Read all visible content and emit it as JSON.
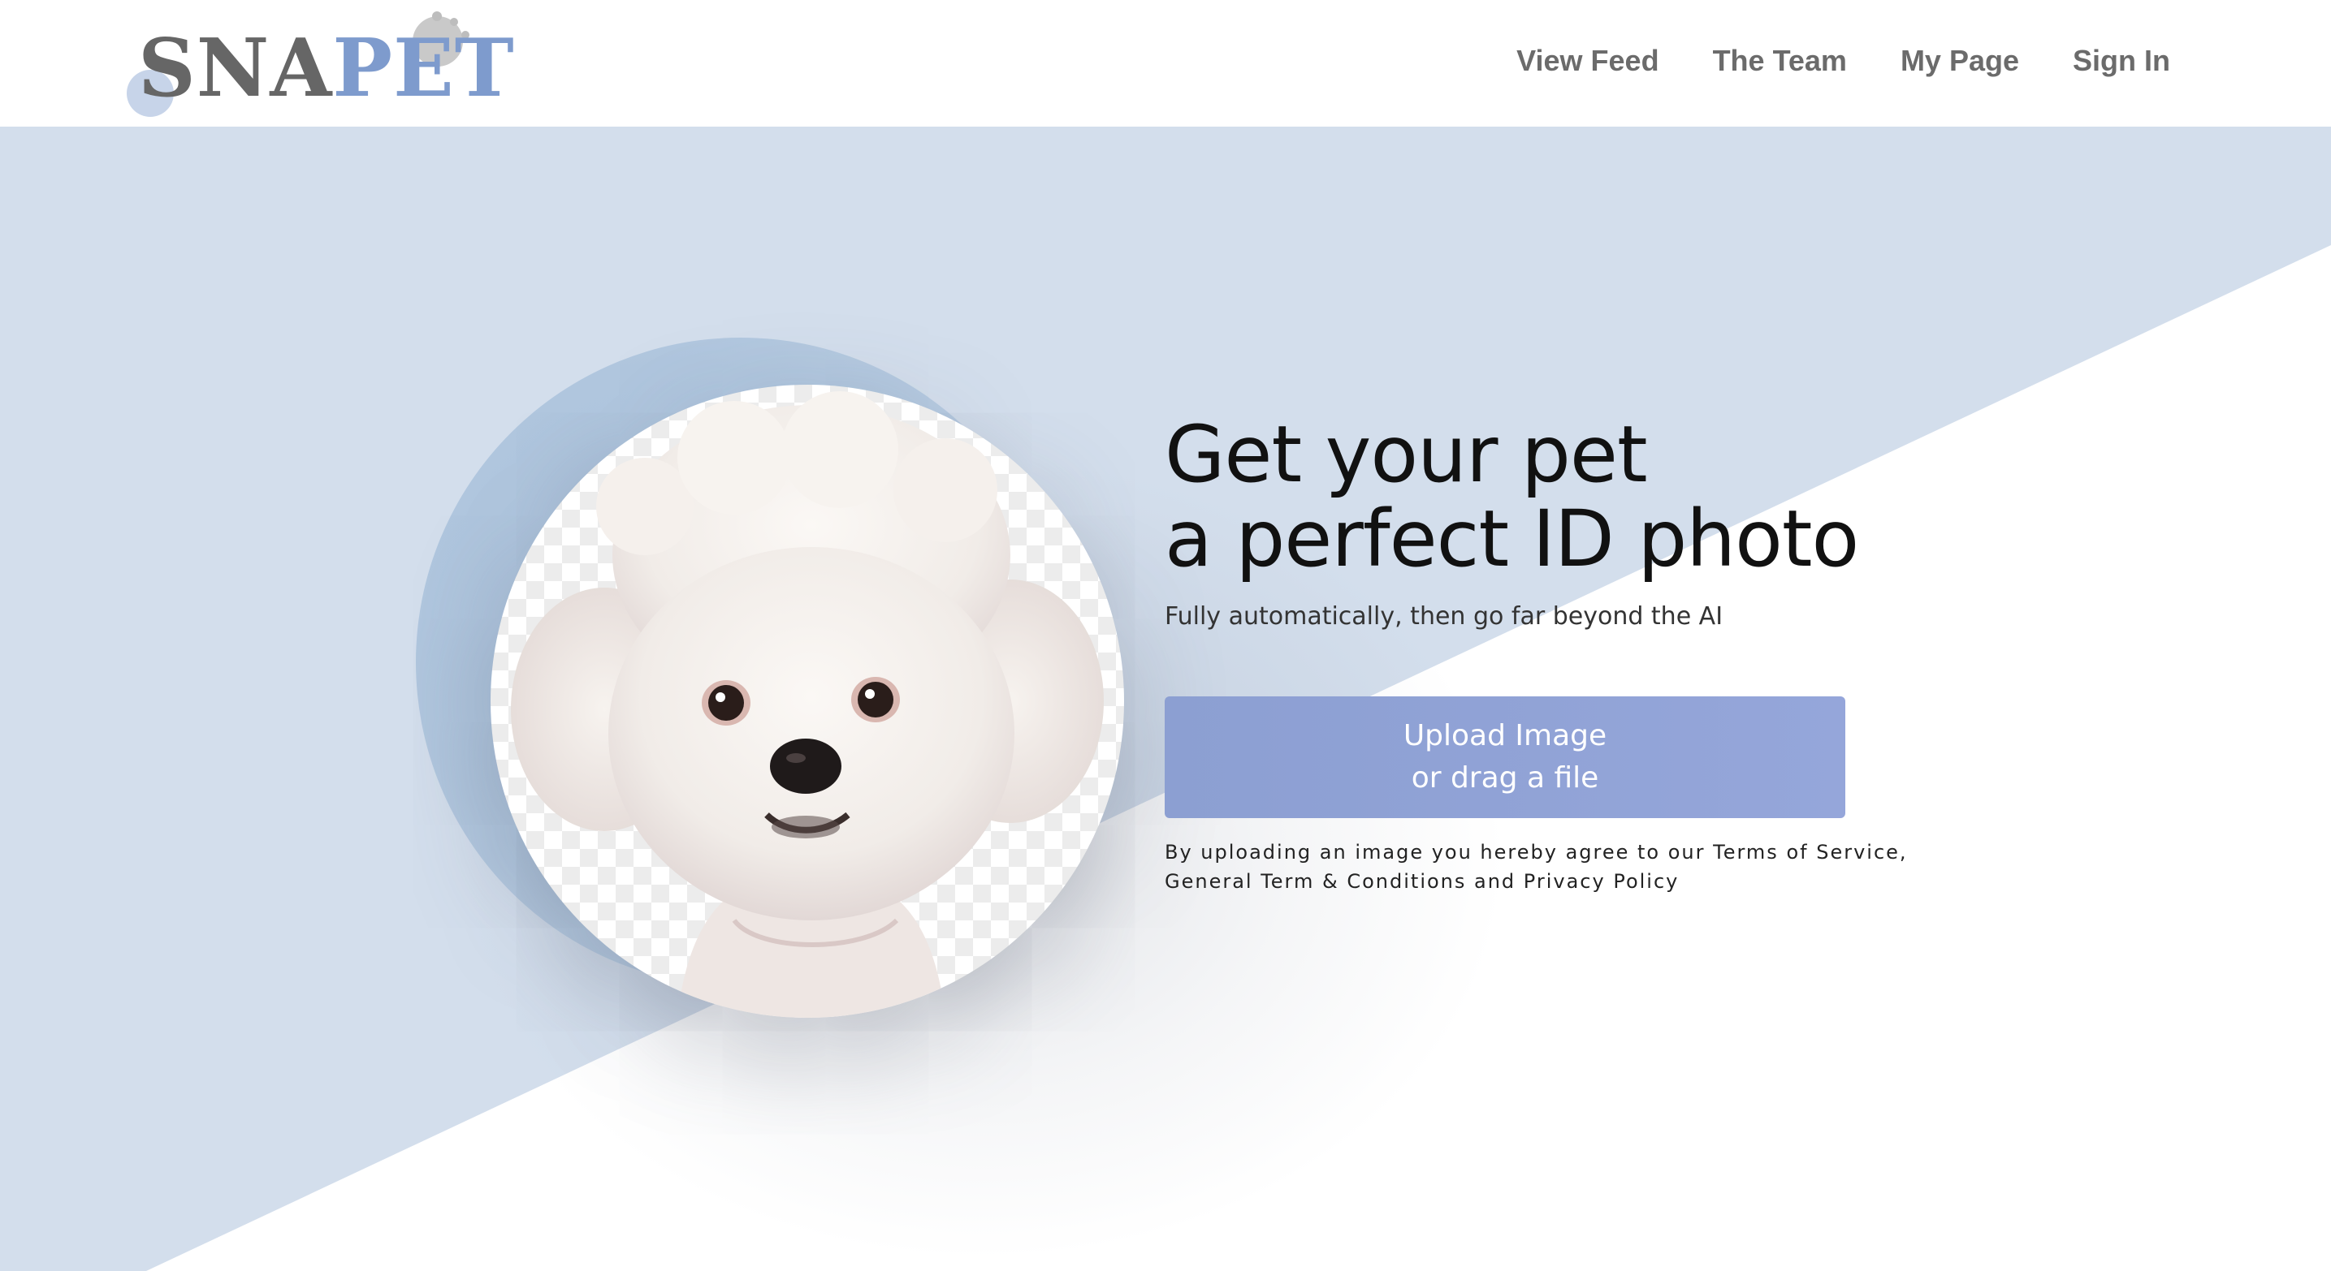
{
  "header": {
    "logo": {
      "text_part_1": "SNA",
      "text_part_2": "PET"
    },
    "nav": [
      {
        "label": "View Feed"
      },
      {
        "label": "The Team"
      },
      {
        "label": "My Page"
      },
      {
        "label": "Sign In"
      }
    ]
  },
  "hero": {
    "headline_line_1": "Get your pet",
    "headline_line_2": "a perfect ID photo",
    "subtitle": "Fully automatically, then go far beyond the AI",
    "upload_button": {
      "line_1": "Upload Image",
      "line_2": "or drag a file"
    },
    "legal_line_1": "By uploading an image you hereby agree to our Terms of Service,",
    "legal_line_2": "General Term & Conditions and Privacy Policy",
    "photo_icon": "dog-photo-icon"
  },
  "colors": {
    "accent_blue": "#7e9bcd",
    "hero_band": "#d3deec",
    "button": "#8fa2d6",
    "logo_gray": "#666666"
  }
}
